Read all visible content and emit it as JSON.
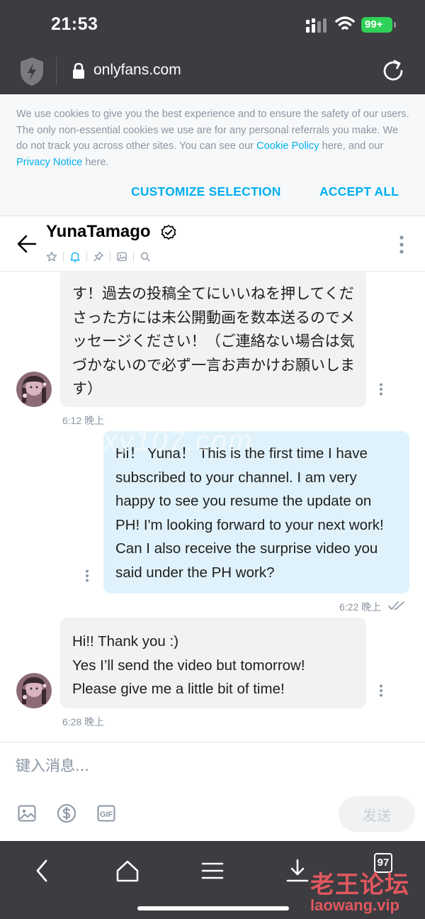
{
  "status_bar": {
    "time": "21:53",
    "battery": "99+"
  },
  "browser": {
    "url": "onlyfans.com",
    "tab_count": "97"
  },
  "cookie_banner": {
    "text_before_cookie": "We use cookies to give you the best experience and to ensure the safety of our users. The only non-essential cookies we use are for any personal referrals you make. We do not track you across other sites. You can see our ",
    "cookie_link": "Cookie Policy",
    "text_middle": " here, and our ",
    "privacy_link": "Privacy Notice",
    "text_after": " here.",
    "customize_label": "CUSTOMIZE SELECTION",
    "accept_label": "ACCEPT ALL"
  },
  "chat": {
    "contact_name": "YunaTamago",
    "messages": [
      {
        "direction": "incoming",
        "text": "す！過去の投稿全てにいいねを押してくださった方には未公開動画を数本送るのでメッセージください！（ご連絡ない場合は気づかないので必ず一言お声かけお願いします）",
        "time": "6:12 晚上"
      },
      {
        "direction": "outgoing",
        "text": "Hi！ Yuna！ This is the first time I have subscribed to your channel. I am very happy to see you resume the update on PH! I'm looking forward to your next work! Can I also receive the surprise video you said under the PH work?",
        "time": "6:22 晚上"
      },
      {
        "direction": "incoming",
        "text": "Hi!! Thank you :)\nYes I’ll send the video but tomorrow!\nPlease give me a little bit of time!",
        "time": "6:28 晚上"
      }
    ]
  },
  "composer": {
    "placeholder": "键入消息...",
    "send_label": "发送",
    "gif_label": "GIF"
  },
  "watermark": {
    "cn": "老王论坛",
    "en": "laowang.vip",
    "overlay": "xy107.com"
  },
  "colors": {
    "accent": "#00aff0",
    "chrome": "#3c3c41",
    "incoming_bubble": "#f2f2f2",
    "outgoing_bubble": "#dff2fb",
    "battery": "#30d158"
  },
  "icons": [
    "shield-icon",
    "lock-icon",
    "reload-icon",
    "back-arrow-icon",
    "verified-icon",
    "star-icon",
    "bell-icon",
    "pin-icon",
    "image-icon",
    "search-icon",
    "more-vertical-icon",
    "image-upload-icon",
    "dollar-icon",
    "gif-icon",
    "nav-back-icon",
    "home-icon",
    "menu-icon",
    "download-icon"
  ]
}
